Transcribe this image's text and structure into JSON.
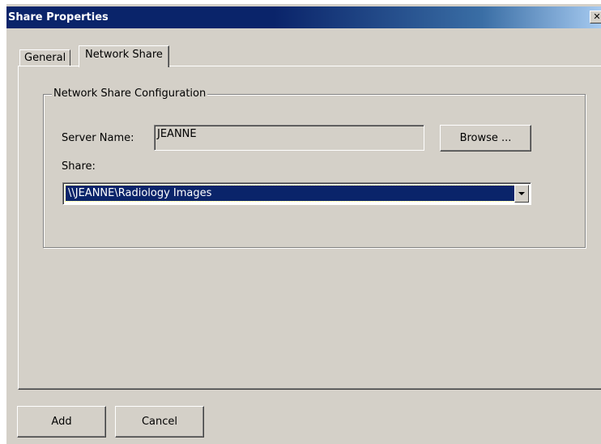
{
  "window": {
    "title": "Share Properties",
    "close_label": "✕"
  },
  "tabs": [
    {
      "label": "General"
    },
    {
      "label": "Network Share"
    }
  ],
  "group": {
    "label": "Network Share Configuration",
    "server_name_label": "Server Name:",
    "server_name_value": "JEANNE",
    "browse_label": "Browse ...",
    "share_label": "Share:",
    "share_value": "\\\\JEANNE\\Radiology Images"
  },
  "buttons": {
    "add_label": "Add",
    "cancel_label": "Cancel"
  }
}
